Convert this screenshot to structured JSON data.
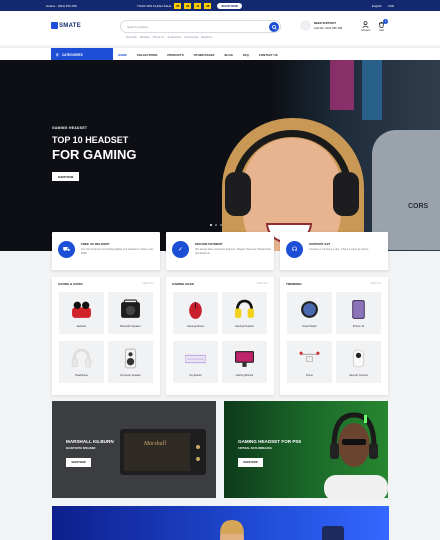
{
  "topbar": {
    "hotline": "Hotline : (623) 456-789",
    "promo": "YOUR 30% FLASH SALE",
    "countdown": [
      "05",
      "24",
      "11",
      "38"
    ],
    "shop_now": "SHOP NOW",
    "language": "English",
    "currency": "USD"
  },
  "header": {
    "logo": "SMATE",
    "search_placeholder": "Search product...",
    "tags": [
      "Flat tooth",
      "Wireless",
      "iPhone 17",
      "Smartwatch",
      "Accessories",
      "Earphone"
    ],
    "support_title": "NEED SUPPORT",
    "support_phone": "Call Me: 0123 456 789",
    "account": "Account",
    "cart": "Cart",
    "cart_count": "0"
  },
  "nav": {
    "categories": "CATEGORIES",
    "links": [
      "HOME",
      "COLLECTIONS",
      "PRODUCTS",
      "OTHER PAGES",
      "BLOG",
      "FAQ",
      "CONTACT US"
    ]
  },
  "hero": {
    "subtitle": "GAMING HEADSET",
    "title_line1": "TOP 10 HEADSET",
    "title_line2": "FOR GAMING",
    "button": "SHOP NOW",
    "brand_text": "CORS"
  },
  "features": [
    {
      "title": "FREE US DELIVERY",
      "desc": "For US customers (including Alaska and Hawaii) or orders over $200",
      "icon": "truck-icon"
    },
    {
      "title": "SECURE PAYMENT",
      "desc": "We accept Visa, American Express, Paypal, Payoneer Mastercard and Discover",
      "icon": "shield-icon"
    },
    {
      "title": "SUPPORT 24/7",
      "desc": "Contact us 24 hours a day, 7 days a week by phone",
      "icon": "headset-icon"
    }
  ],
  "category_cards": [
    {
      "title": "SAVING & AUDIO",
      "view_all": "VIEW ALL",
      "items": [
        "Earbuds",
        "Bluetooth Speaker",
        "Headphone",
        "Computer Speaker"
      ]
    },
    {
      "title": "GAMING GEAR",
      "view_all": "VIEW ALL",
      "items": [
        "Gaming Mouse",
        "Gaming Headset",
        "Keyboards",
        "Gaming Monitor"
      ]
    },
    {
      "title": "TRENDING",
      "view_all": "VIEW ALL",
      "items": [
        "Smart Watch",
        "iPhone 14",
        "Drone",
        "Security Camera"
      ]
    }
  ],
  "banners": [
    {
      "subtitle": "",
      "title": "MARSHALL KILBURN",
      "tagline": "BLUETOOTH SPEAKER",
      "button": "SHOP NOW"
    },
    {
      "subtitle": "",
      "title": "GAMING HEADSET FOR PS5",
      "tagline": "CRITICAL DATA WIRELESS",
      "button": "SHOP NOW"
    }
  ]
}
